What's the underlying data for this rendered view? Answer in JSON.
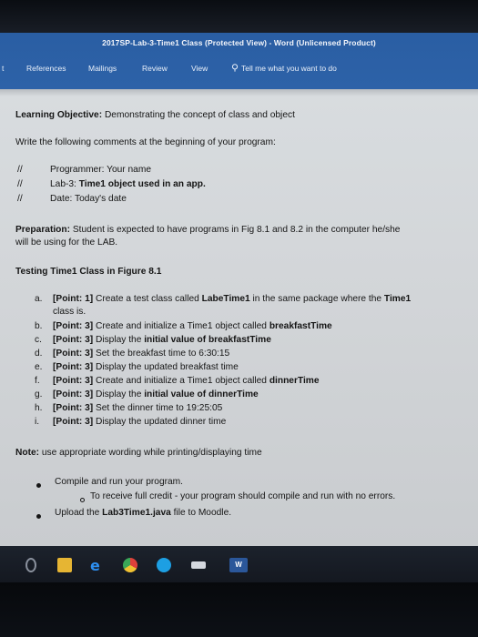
{
  "window": {
    "title": "2017SP-Lab-3-Time1 Class (Protected View)  -  Word (Unlicensed Product)"
  },
  "ribbon": {
    "tabs": [
      {
        "label": "t"
      },
      {
        "label": "References"
      },
      {
        "label": "Mailings"
      },
      {
        "label": "Review"
      },
      {
        "label": "View"
      }
    ],
    "tell_me": "Tell me what you want to do"
  },
  "document": {
    "objective_label": "Learning Objective:",
    "objective_text": " Demonstrating the concept of class and object",
    "instruction": "Write the following comments at the beginning of your program:",
    "comments": [
      {
        "marker": "//",
        "text_plain": "Programmer: Your name",
        "text_bold": ""
      },
      {
        "marker": "//",
        "text_plain": "Lab-3: ",
        "text_bold": "Time1 object used in an app."
      },
      {
        "marker": "//",
        "text_plain": "Date: Today's date",
        "text_bold": ""
      }
    ],
    "preparation_label": "Preparation:",
    "preparation_line1": " Student is expected to have programs in Fig 8.1 and 8.2 in the computer he/she",
    "preparation_line2": "will be using for the LAB.",
    "testing_heading": "Testing Time1 Class in Figure 8.1",
    "tasks": [
      {
        "letter": "a.",
        "pts": "[Point: 1]",
        "parts": [
          " Create a test class called ",
          "LabeTime1",
          " in the same package where the ",
          "Time1"
        ],
        "cont": "class is."
      },
      {
        "letter": "b.",
        "pts": "[Point: 3]",
        "parts": [
          " Create and initialize a Time1 object called ",
          "breakfastTime",
          "",
          ""
        ],
        "cont": ""
      },
      {
        "letter": "c.",
        "pts": "[Point: 3]",
        "parts": [
          " Display the ",
          "initial value of breakfastTime",
          "",
          ""
        ],
        "cont": ""
      },
      {
        "letter": "d.",
        "pts": "[Point: 3]",
        "parts": [
          " Set the breakfast time to 6:30:15",
          "",
          "",
          ""
        ],
        "cont": ""
      },
      {
        "letter": "e.",
        "pts": "[Point: 3]",
        "parts": [
          " Display the updated breakfast time",
          "",
          "",
          ""
        ],
        "cont": ""
      },
      {
        "letter": "f.",
        "pts": "[Point: 3]",
        "parts": [
          " Create and initialize a Time1 object called ",
          "dinnerTime",
          "",
          ""
        ],
        "cont": ""
      },
      {
        "letter": "g.",
        "pts": "[Point: 3]",
        "parts": [
          " Display the ",
          "initial value of dinnerTime",
          "",
          ""
        ],
        "cont": ""
      },
      {
        "letter": "h.",
        "pts": "[Point: 3]",
        "parts": [
          " Set the dinner time to 19:25:05",
          "",
          "",
          ""
        ],
        "cont": ""
      },
      {
        "letter": "i.",
        "pts": "[Point: 3]",
        "parts": [
          " Display the updated dinner time",
          "",
          "",
          ""
        ],
        "cont": ""
      }
    ],
    "note_label": "Note:",
    "note_text": " use appropriate wording while printing/displaying time",
    "bullets": [
      {
        "text": "Compile and run your program."
      },
      {
        "sub": "To receive full credit - your program should compile and run with no errors."
      },
      {
        "text_pre": "Upload the ",
        "text_bold": "Lab3Time1.java",
        "text_post": " file to Moodle."
      }
    ]
  },
  "taskbar": {
    "icons": [
      "settings-icon",
      "file-explorer-icon",
      "edge-icon",
      "chrome-icon",
      "skype-icon",
      "mail-icon",
      "word-icon"
    ],
    "word_label": "W"
  }
}
